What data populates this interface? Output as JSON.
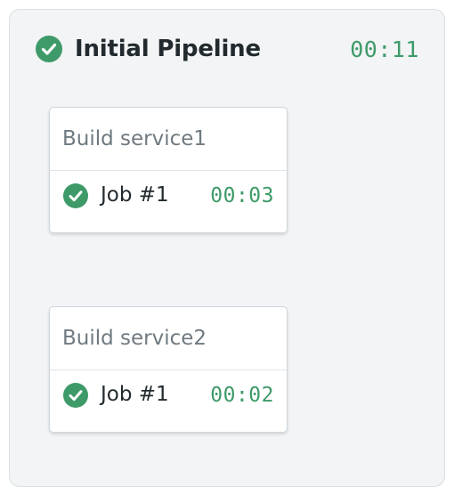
{
  "pipeline": {
    "title": "Initial Pipeline",
    "status_icon": "check-circle-icon",
    "status": "passed",
    "duration": "00:11",
    "blocks": [
      {
        "title": "Build service1",
        "jobs": [
          {
            "label": "Job #1",
            "duration": "00:03",
            "status_icon": "check-circle-icon"
          }
        ]
      },
      {
        "title": "Build service2",
        "jobs": [
          {
            "label": "Job #1",
            "duration": "00:02",
            "status_icon": "check-circle-icon"
          }
        ]
      }
    ]
  },
  "colors": {
    "success": "#3e9a69",
    "panel_background": "#f2f4f5",
    "text_primary": "#222a2e",
    "text_muted": "#6f7a80"
  }
}
